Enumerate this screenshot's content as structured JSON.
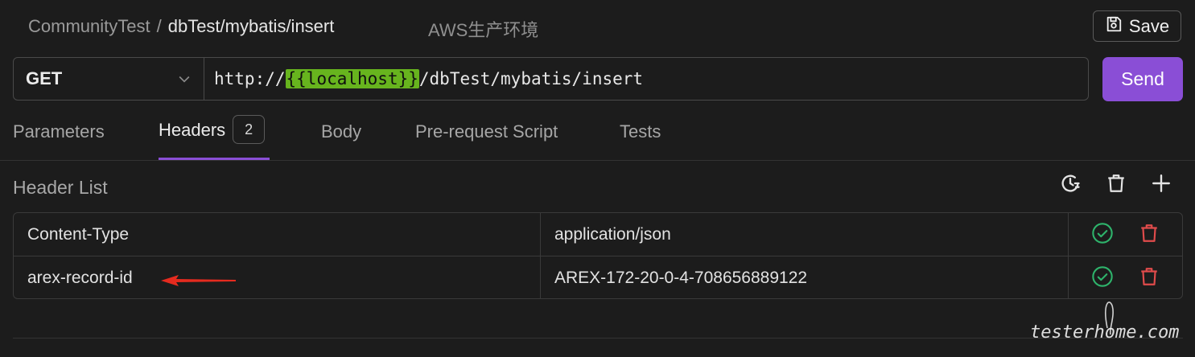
{
  "breadcrumb": {
    "root": "CommunityTest",
    "separator": "/",
    "path": "dbTest/mybatis/insert"
  },
  "environment": "AWS生产环境",
  "toolbar": {
    "save_label": "Save"
  },
  "request": {
    "method": "GET",
    "url_prefix": "http://",
    "url_variable": "{{localhost}}",
    "url_suffix": "/dbTest/mybatis/insert",
    "send_label": "Send"
  },
  "tabs": [
    {
      "label": "Parameters"
    },
    {
      "label": "Headers",
      "count": "2",
      "active": true
    },
    {
      "label": "Body"
    },
    {
      "label": "Pre-request Script"
    },
    {
      "label": "Tests"
    }
  ],
  "header_list": {
    "title": "Header List",
    "rows": [
      {
        "key": "Content-Type",
        "value": "application/json"
      },
      {
        "key": "arex-record-id",
        "value": "AREX-172-20-0-4-708656889122"
      }
    ]
  },
  "watermark": "testerhome.com",
  "colors": {
    "accent": "#8a4ed6",
    "variable_highlight": "#67b41e",
    "enabled": "#2eb36b",
    "delete": "#e04b4b",
    "annotation_arrow": "#e52b1f"
  },
  "icons": {
    "save": "floppy-disk-icon",
    "method_dropdown": "chevron-down-icon",
    "history": "history-clock-icon",
    "clear": "trash-icon",
    "add": "plus-icon",
    "enabled": "check-circle-icon",
    "delete_row": "trash-icon"
  }
}
